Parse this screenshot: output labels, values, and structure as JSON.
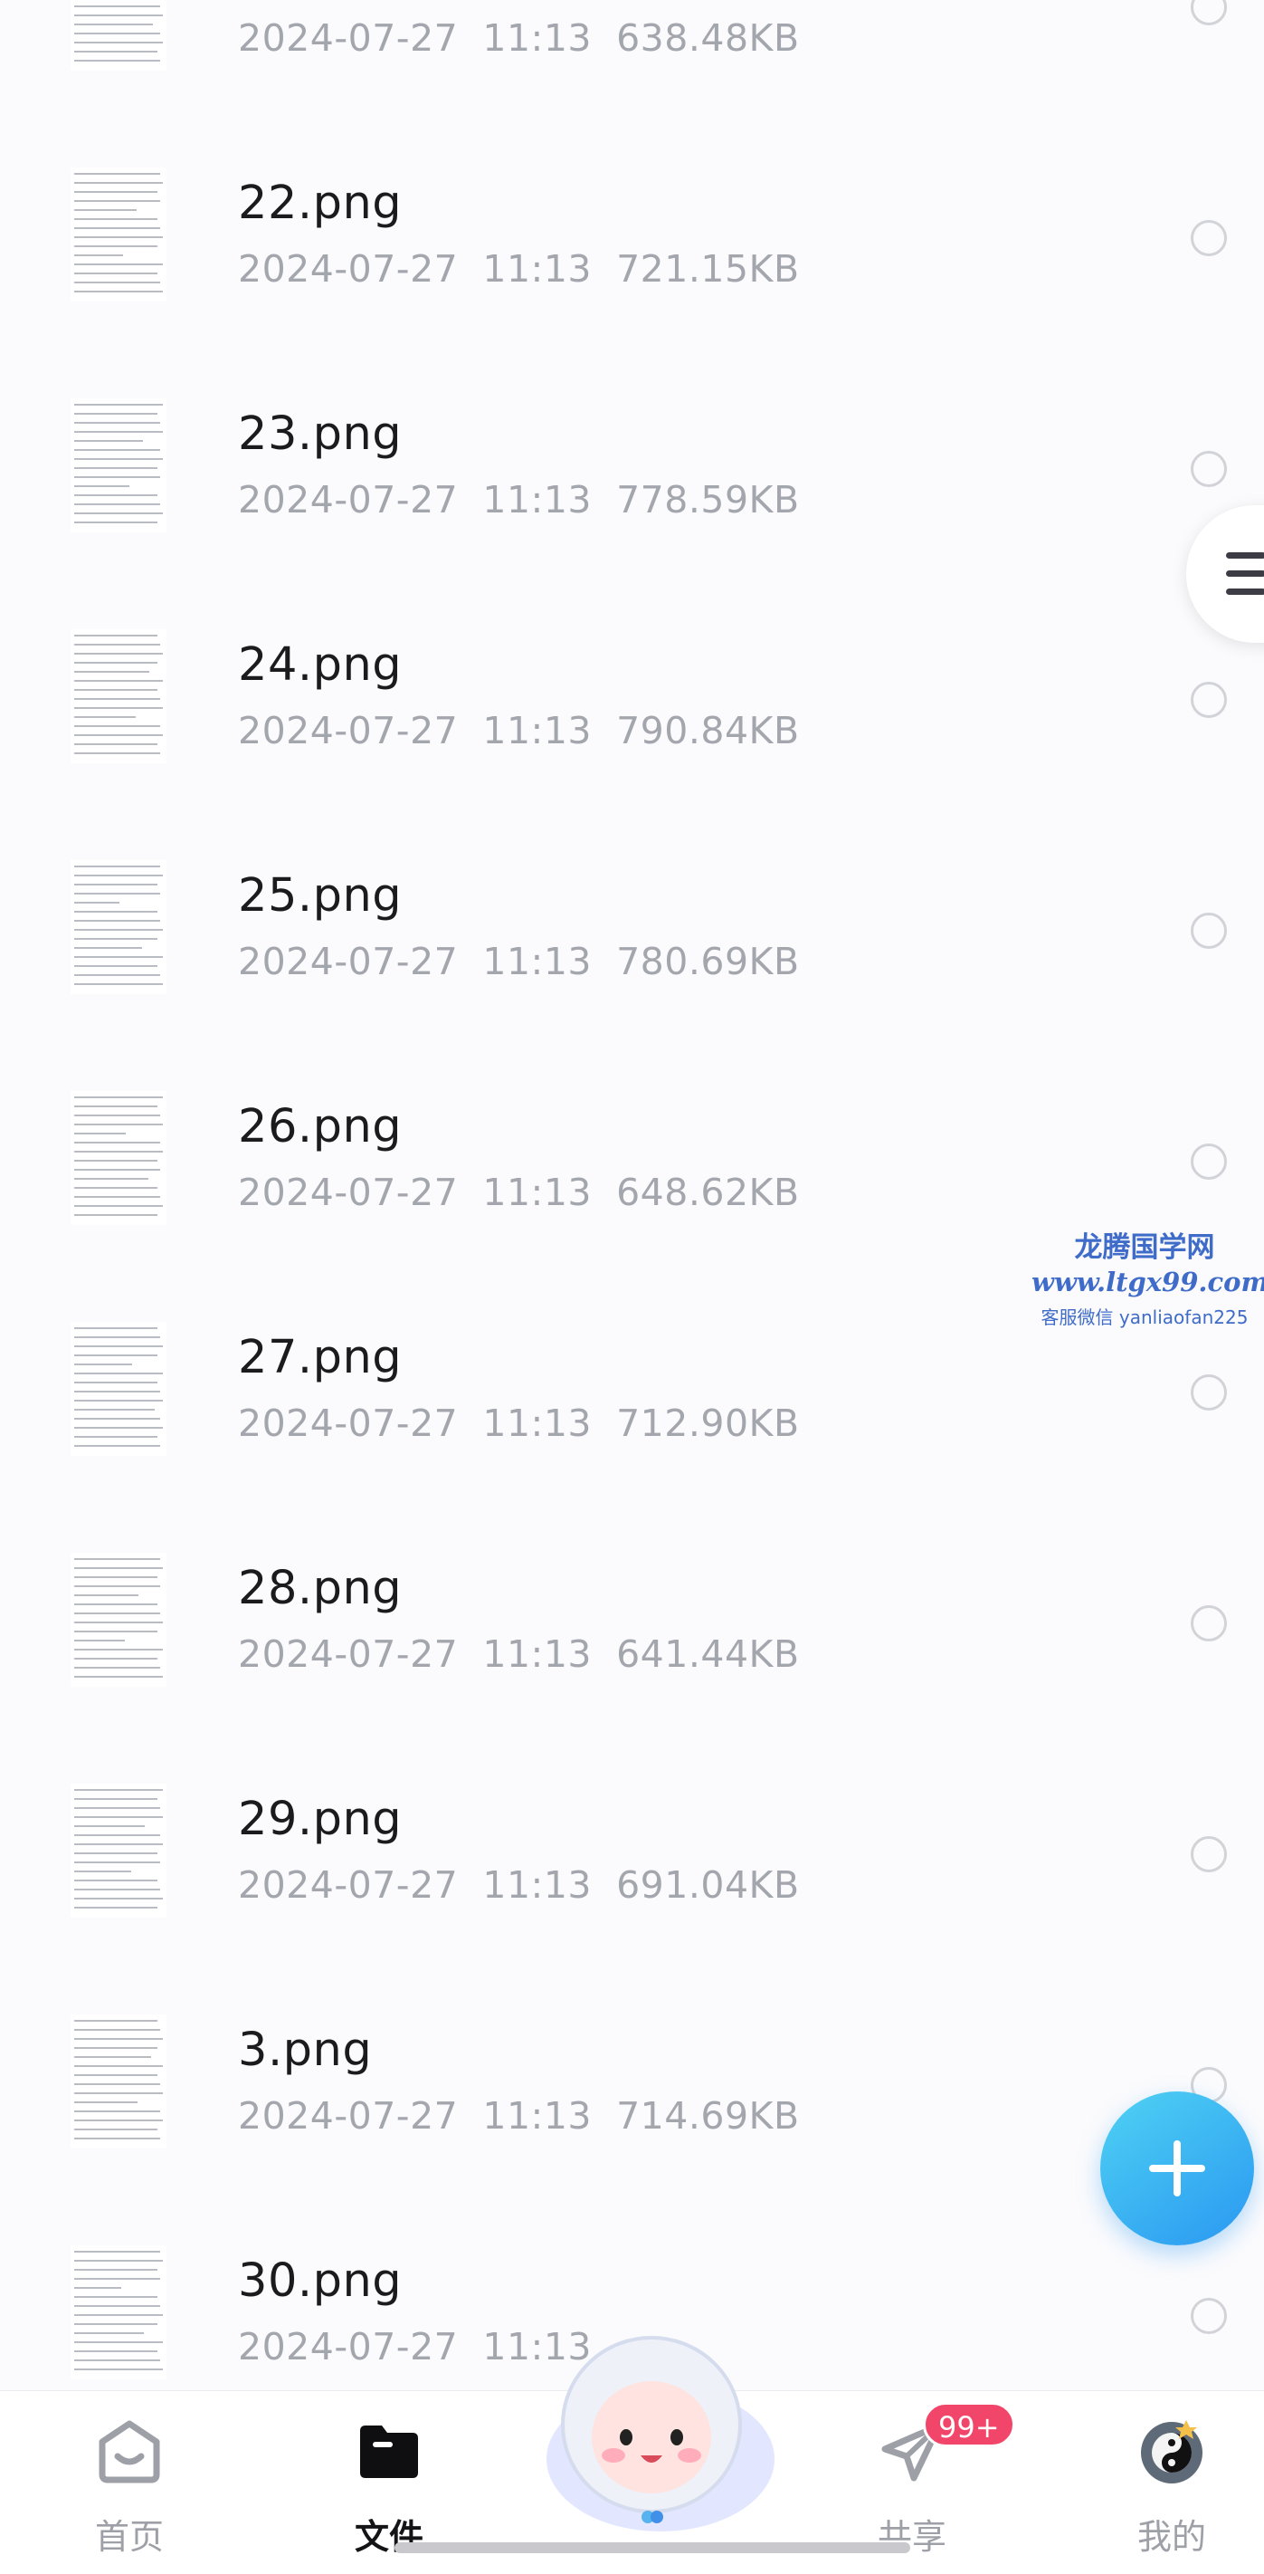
{
  "files": [
    {
      "name": "",
      "date": "2024-07-27",
      "time": "11:13",
      "size": "638.48KB"
    },
    {
      "name": "22.png",
      "date": "2024-07-27",
      "time": "11:13",
      "size": "721.15KB"
    },
    {
      "name": "23.png",
      "date": "2024-07-27",
      "time": "11:13",
      "size": "778.59KB"
    },
    {
      "name": "24.png",
      "date": "2024-07-27",
      "time": "11:13",
      "size": "790.84KB"
    },
    {
      "name": "25.png",
      "date": "2024-07-27",
      "time": "11:13",
      "size": "780.69KB"
    },
    {
      "name": "26.png",
      "date": "2024-07-27",
      "time": "11:13",
      "size": "648.62KB"
    },
    {
      "name": "27.png",
      "date": "2024-07-27",
      "time": "11:13",
      "size": "712.90KB"
    },
    {
      "name": "28.png",
      "date": "2024-07-27",
      "time": "11:13",
      "size": "641.44KB"
    },
    {
      "name": "29.png",
      "date": "2024-07-27",
      "time": "11:13",
      "size": "691.04KB"
    },
    {
      "name": "3.png",
      "date": "2024-07-27",
      "time": "11:13",
      "size": "714.69KB"
    },
    {
      "name": "30.png",
      "date": "2024-07-27",
      "time": "11:13",
      "size": ""
    }
  ],
  "watermark": {
    "title": "龙腾国学网",
    "url": "www.ltgx99.com",
    "contact": "客服微信 yanliaofan225"
  },
  "nav": {
    "home": "首页",
    "files": "文件",
    "share": "共享",
    "share_badge": "99+",
    "me": "我的"
  },
  "icons": {
    "fab": "plus-icon",
    "float_menu": "menu-icon"
  },
  "colors": {
    "accent": "#2a98f2",
    "badge": "#f2456a",
    "watermark": "#3f6cc9"
  }
}
